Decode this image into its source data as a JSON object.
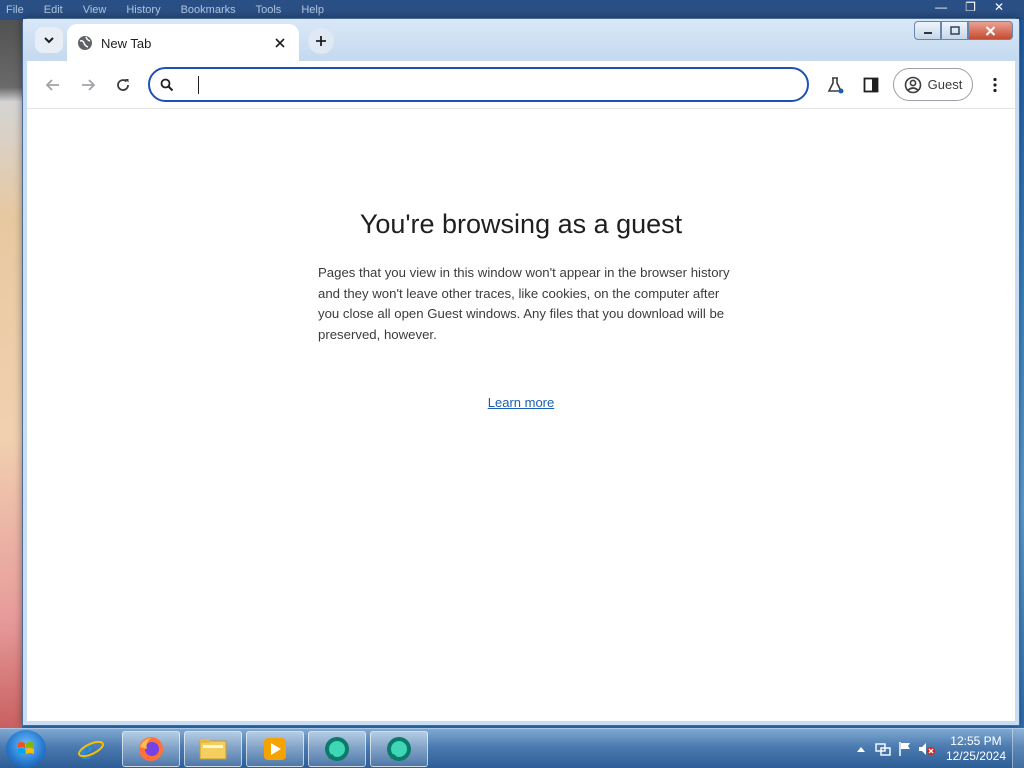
{
  "background": {
    "menu_items": [
      "File",
      "Edit",
      "View",
      "History",
      "Bookmarks",
      "Tools",
      "Help"
    ]
  },
  "browser": {
    "tab": {
      "title": "New Tab"
    },
    "omnibox": {
      "value": "",
      "placeholder": ""
    },
    "profile": {
      "label": "Guest"
    }
  },
  "page": {
    "title": "You're browsing as a guest",
    "description": "Pages that you view in this window won't appear in the browser history and they won't leave other traces, like cookies, on the computer after you close all open Guest windows. Any files that you download will be preserved, however.",
    "learn_more": "Learn more"
  },
  "taskbar": {
    "apps": [
      "internet-explorer",
      "firefox",
      "file-explorer",
      "media-player",
      "chrome-app-1",
      "chrome-app-2"
    ],
    "clock": {
      "time": "12:55 PM",
      "date": "12/25/2024"
    }
  },
  "colors": {
    "accent": "#1a52b8",
    "link": "#1a5fb4"
  }
}
